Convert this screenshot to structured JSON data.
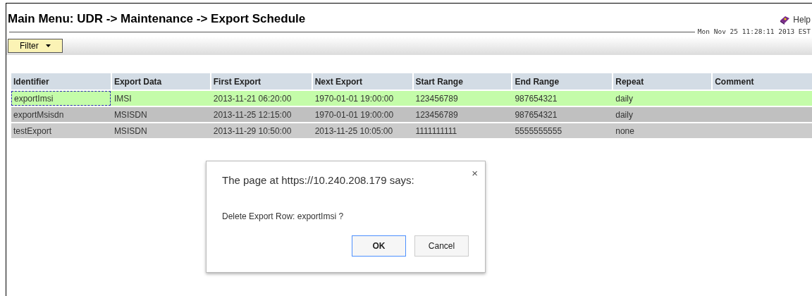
{
  "header": {
    "title": "Main Menu: UDR -> Maintenance -> Export Schedule",
    "help": "Help",
    "timestamp": "Mon Nov 25 11:28:11 2013 EST"
  },
  "toolbar": {
    "filter": "Filter"
  },
  "table": {
    "columns": [
      "Identifier",
      "Export Data",
      "First Export",
      "Next Export",
      "Start Range",
      "End Range",
      "Repeat",
      "Comment"
    ],
    "rows": [
      {
        "selected": true,
        "cells": [
          "exportImsi",
          "IMSI",
          "2013-11-21 06:20:00",
          "1970-01-01 19:00:00",
          "123456789",
          "987654321",
          "daily",
          ""
        ]
      },
      {
        "selected": false,
        "cells": [
          "exportMsisdn",
          "MSISDN",
          "2013-11-25 12:15:00",
          "1970-01-01 19:00:00",
          "123456789",
          "987654321",
          "daily",
          ""
        ]
      },
      {
        "selected": false,
        "cells": [
          "testExport",
          "MSISDN",
          "2013-11-29 10:50:00",
          "2013-11-25 10:05:00",
          "1111111111",
          "5555555555",
          "none",
          ""
        ]
      }
    ]
  },
  "dialog": {
    "title": "The page at https://10.240.208.179 says:",
    "message": "Delete Export Row: exportImsi ?",
    "close": "×",
    "buttons": [
      {
        "label": "OK",
        "kind": "primary"
      },
      {
        "label": "Cancel",
        "kind": "secondary"
      }
    ]
  }
}
